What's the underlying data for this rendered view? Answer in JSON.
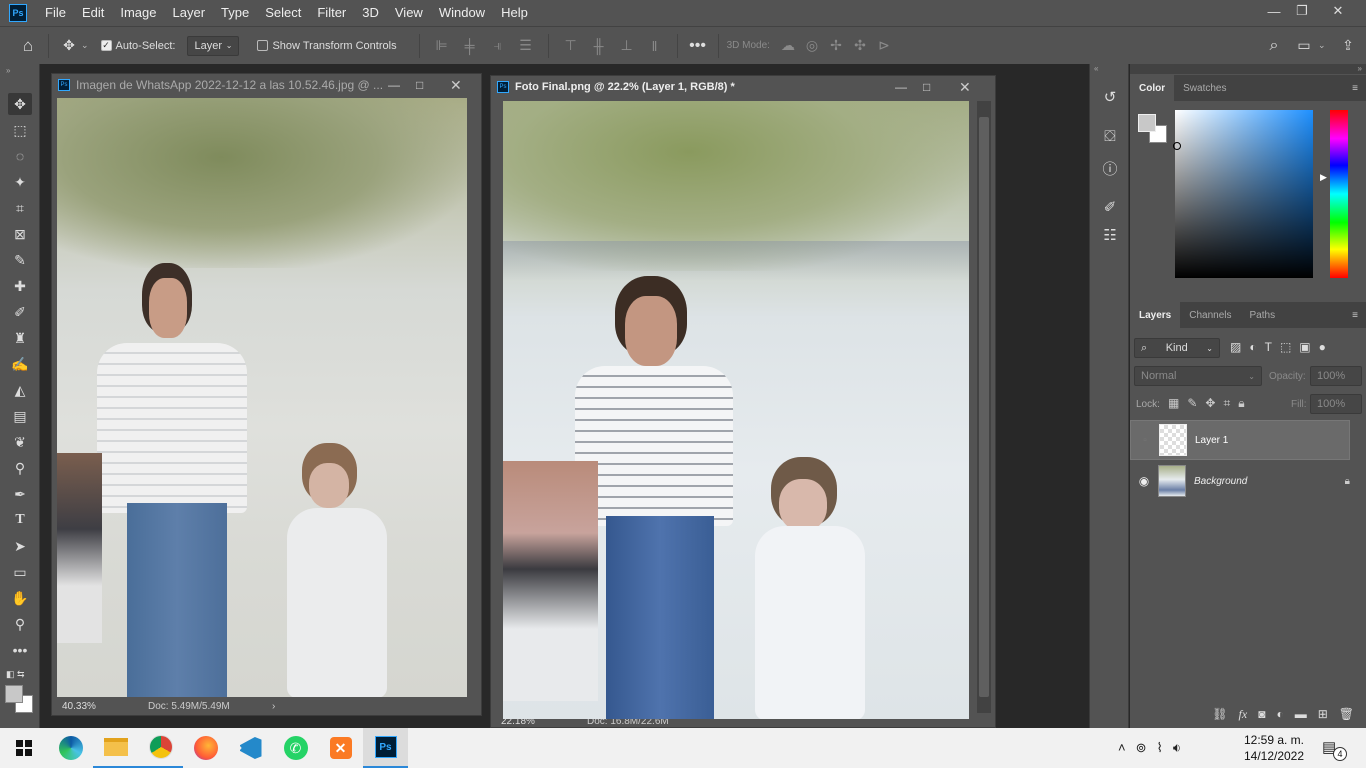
{
  "menubar": {
    "items": [
      "File",
      "Edit",
      "Image",
      "Layer",
      "Type",
      "Select",
      "Filter",
      "3D",
      "View",
      "Window",
      "Help"
    ]
  },
  "options": {
    "auto_select_label": "Auto-Select:",
    "auto_select_value": "Layer",
    "transform_label": "Show Transform Controls",
    "mode_3d_label": "3D Mode:"
  },
  "doc1": {
    "title": "Imagen de WhatsApp 2022-12-12 a las 10.52.46.jpg @ ...",
    "zoom": "40.33%",
    "doc_size": "Doc: 5.49M/5.49M"
  },
  "doc2": {
    "title": "Foto Final.png @ 22.2% (Layer 1, RGB/8) *",
    "zoom": "22.18%",
    "doc_size": "Doc: 16.8M/22.6M"
  },
  "color_panel": {
    "tabs": [
      "Color",
      "Swatches"
    ]
  },
  "layers_panel": {
    "tabs": [
      "Layers",
      "Channels",
      "Paths"
    ],
    "filter_label": "Kind",
    "blend_mode": "Normal",
    "opacity_label": "Opacity:",
    "opacity_value": "100%",
    "lock_label": "Lock:",
    "fill_label": "Fill:",
    "fill_value": "100%",
    "layers": [
      {
        "name": "Layer 1",
        "visible": false,
        "selected": true
      },
      {
        "name": "Background",
        "visible": true,
        "locked": true
      }
    ]
  },
  "taskbar": {
    "time": "12:59 a. m.",
    "date": "14/12/2022",
    "notification_count": "4"
  }
}
